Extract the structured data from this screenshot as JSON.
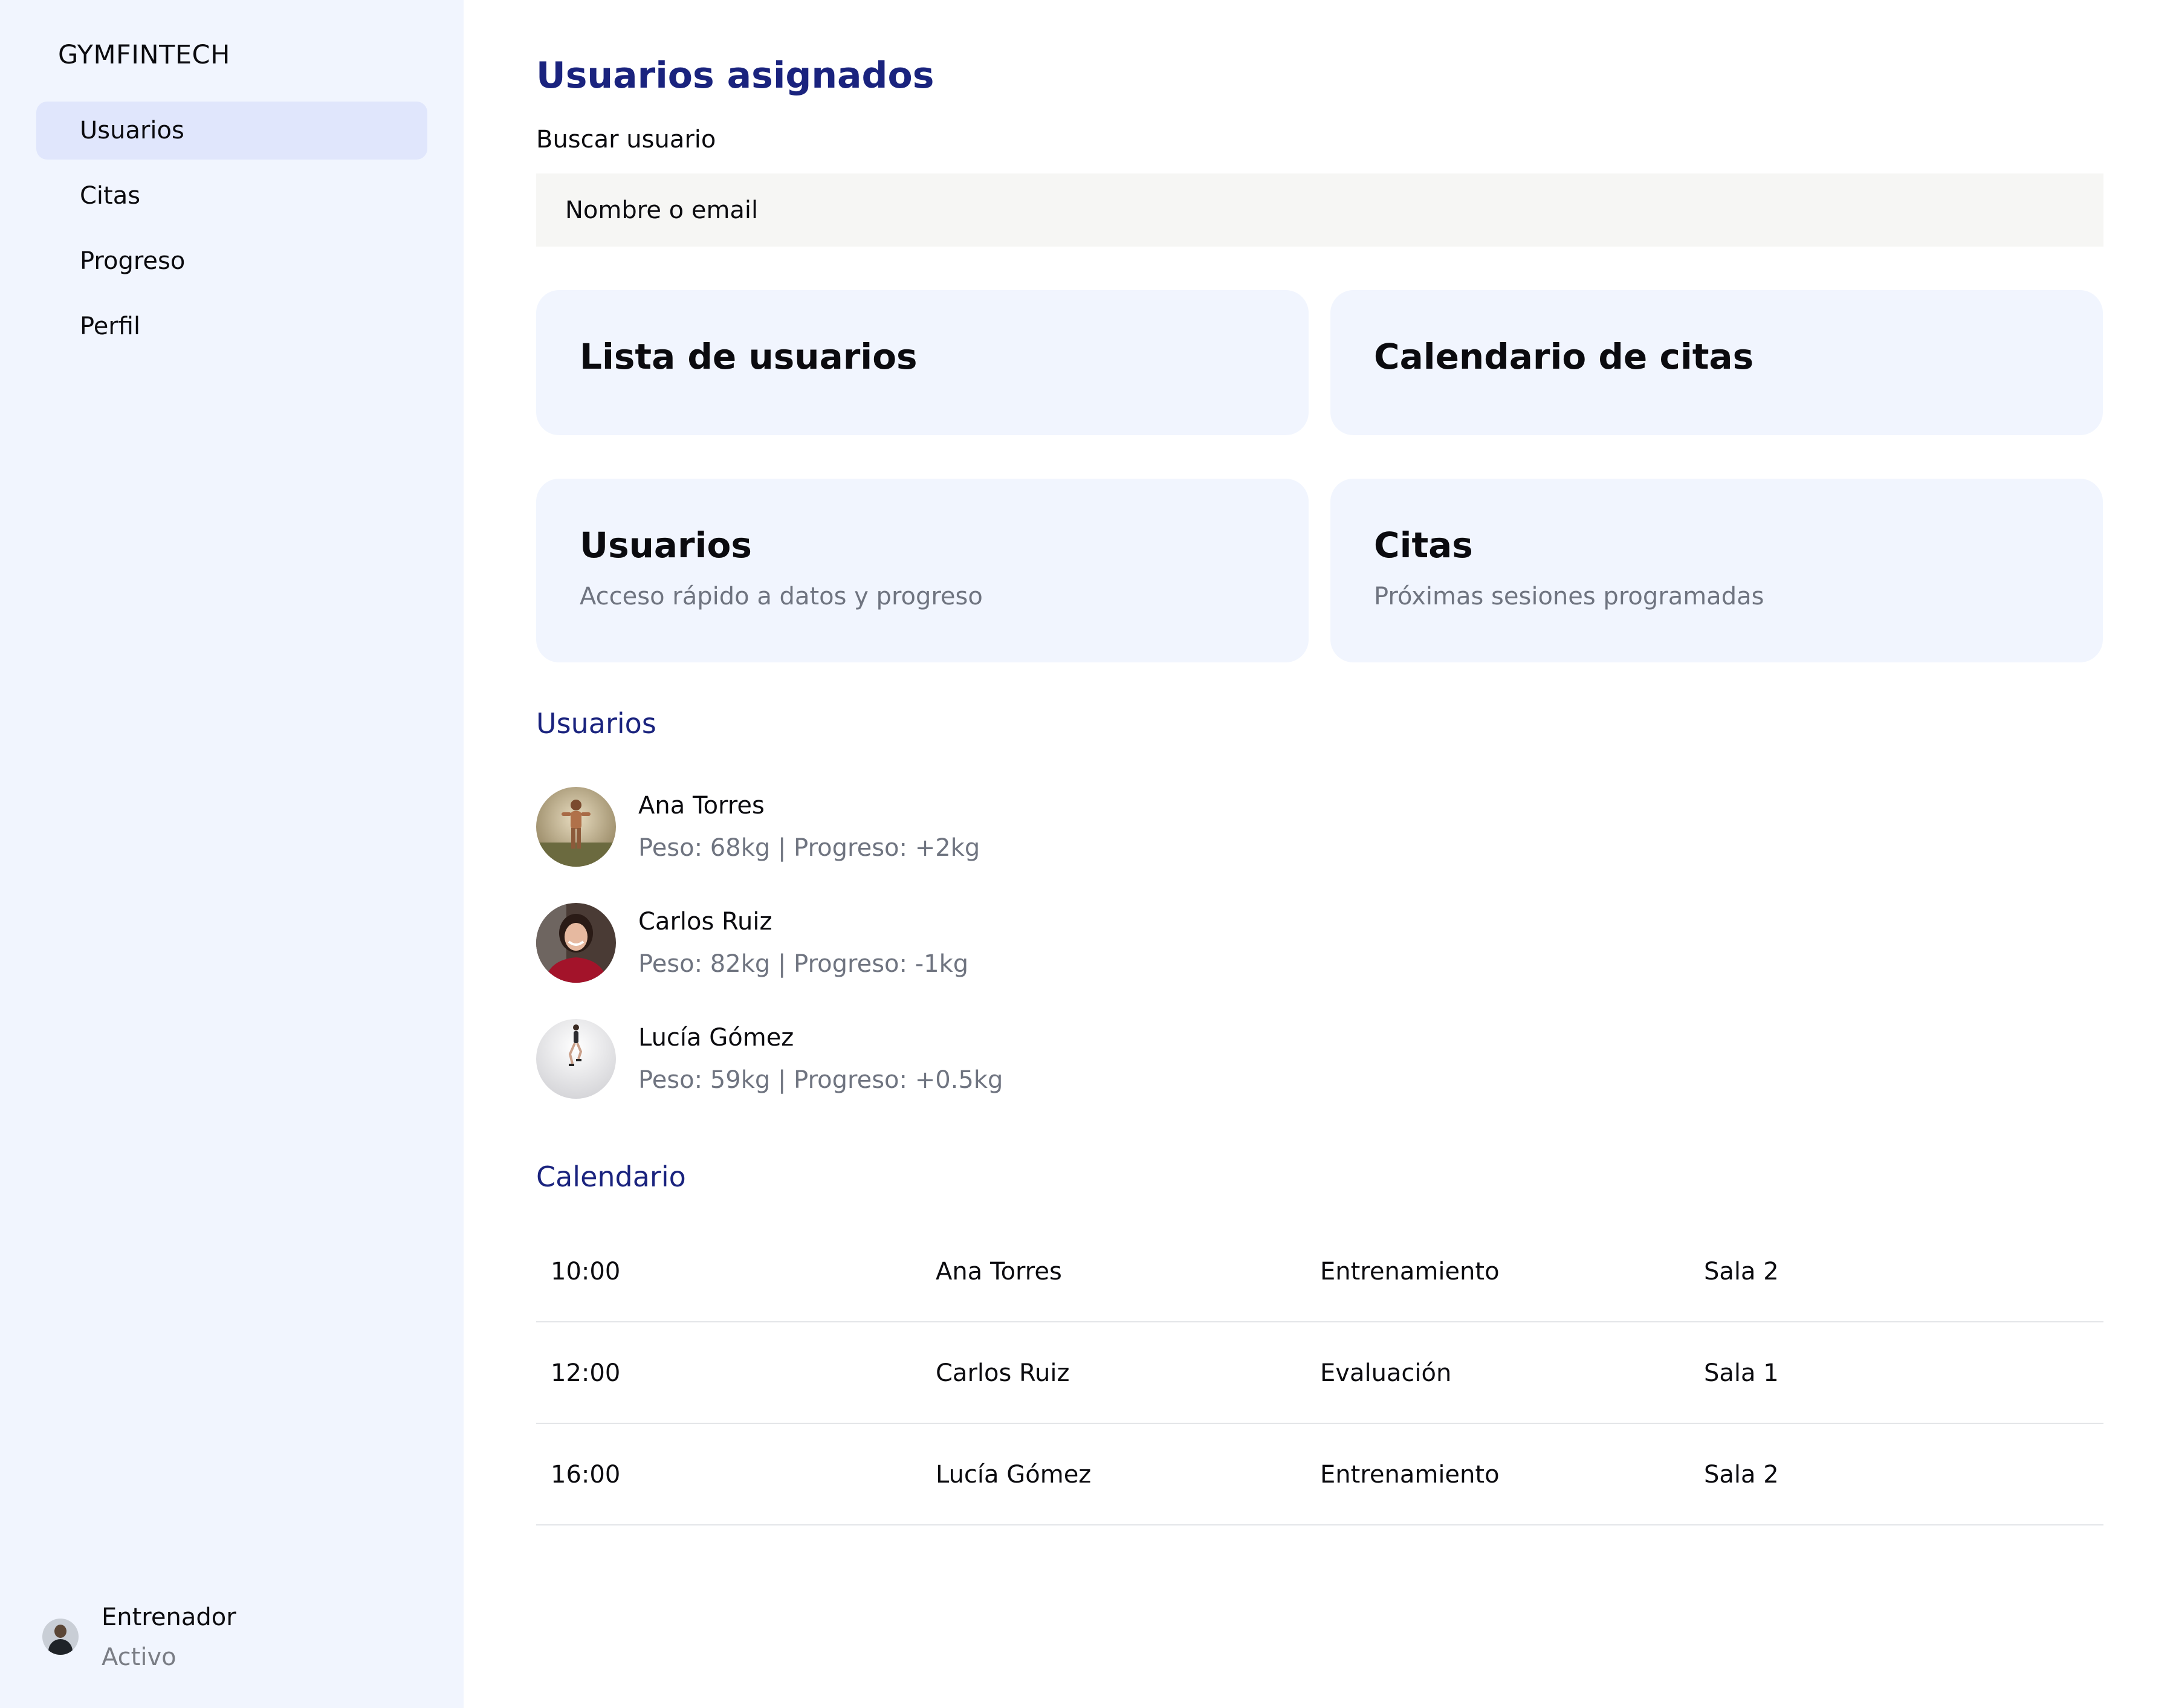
{
  "app": {
    "brand": "GYMFINTECH"
  },
  "sidebar": {
    "items": [
      {
        "label": "Usuarios"
      },
      {
        "label": "Citas"
      },
      {
        "label": "Progreso"
      },
      {
        "label": "Perfil"
      }
    ],
    "profile": {
      "role": "Entrenador",
      "status": "Activo"
    }
  },
  "main": {
    "title": "Usuarios asignados",
    "search": {
      "label": "Buscar usuario",
      "placeholder": "Nombre o email"
    },
    "cards": [
      {
        "title": "Lista de usuarios"
      },
      {
        "title": "Calendario de citas"
      },
      {
        "title": "Usuarios",
        "subtitle": "Acceso rápido a datos y progreso"
      },
      {
        "title": "Citas",
        "subtitle": "Próximas sesiones programadas"
      }
    ],
    "users_section": {
      "title": "Usuarios",
      "users": [
        {
          "name": "Ana Torres",
          "stats": "Peso: 68kg | Progreso: +2kg"
        },
        {
          "name": "Carlos Ruiz",
          "stats": "Peso: 82kg | Progreso: -1kg"
        },
        {
          "name": "Lucía Gómez",
          "stats": "Peso: 59kg | Progreso: +0.5kg"
        }
      ]
    },
    "calendar": {
      "title": "Calendario",
      "rows": [
        {
          "time": "10:00",
          "user": "Ana Torres",
          "type": "Entrenamiento",
          "room": "Sala 2"
        },
        {
          "time": "12:00",
          "user": "Carlos Ruiz",
          "type": "Evaluación",
          "room": "Sala 1"
        },
        {
          "time": "16:00",
          "user": "Lucía Gómez",
          "type": "Entrenamiento",
          "room": "Sala 2"
        }
      ]
    }
  },
  "colors": {
    "accent": "#1a237e",
    "sidebar_bg": "#f1f5fe",
    "active_item_bg": "#e0e6fc",
    "card_bg": "#f1f5fe",
    "muted_text": "#6f7480"
  }
}
